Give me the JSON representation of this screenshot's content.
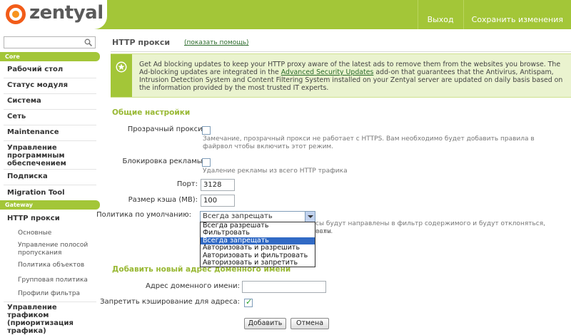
{
  "brand": {
    "logo_text": "zentyal"
  },
  "header": {
    "logout": "Выход",
    "save_changes": "Сохранить изменения"
  },
  "search": {
    "placeholder": ""
  },
  "sidebar": {
    "core_heading": "Core",
    "core_items": [
      "Рабочий стол",
      "Статус модуля",
      "Система",
      "Сеть",
      "Maintenance",
      "Управление программным обеспечением",
      "Подписка",
      "Migration Tool"
    ],
    "gateway_heading": "Gateway",
    "http_proxy": "HTTP прокси",
    "http_proxy_sub": [
      "Основные",
      "Управление полосой пропускания",
      "Политика объектов",
      "Групповая политика",
      "Профили фильтра"
    ],
    "traffic_shaping": "Управление трафиком (приоритизация трафика)"
  },
  "main": {
    "title": "HTTP прокси",
    "help_link": "(показать помощь)",
    "notice": {
      "text_1": "Get Ad blocking updates to keep your HTTP proxy aware of the latest ads to remove them from the websites you browse. The Ad-blocking updates are integrated in the ",
      "link": "Advanced Security Updates",
      "text_2": " add-on that guarantees that the Antivirus, Antispam, Intrusion Detection System and Content Filtering System installed on your Zentyal server are updated on daily basis based on the information provided by the most trusted IT experts."
    },
    "general": {
      "heading": "Общие настройки",
      "transparent_label": "Прозрачный прокси:",
      "transparent_checked": false,
      "transparent_hint": "Замечание, прозрачный прокси не работает с HTTPS. Вам необходимо будет добавить правила в файрвол чтобы включить этот режим.",
      "adblock_label": "Блокировка рекламы:",
      "adblock_checked": false,
      "adblock_hint": "Удаление рекламы из всего HTTP трафика",
      "port_label": "Порт:",
      "port_value": "3128",
      "cache_label": "Размер кэша (MB):",
      "cache_value": "100",
      "policy_label": "Политика по умолчанию:",
      "policy_value": "Всегда запрещать",
      "policy_options": [
        "Всегда разрешать",
        "Фильтровать",
        "Всегда запрещать",
        "Авторизовать и разрешить",
        "Авторизовать и фильтровать",
        "Авторизовать и запретить"
      ],
      "policy_selected_index": 2,
      "policy_hint_line1": "сы будут направлены в фильтр содержимого и будут отклоняться, если",
      "policy_hint_line2": "вать."
    },
    "add_domain": {
      "heading": "Добавить новый адрес доменного имени",
      "domain_label": "Адрес доменного имени:",
      "domain_value": "",
      "nocache_label": "Запретить кэширование для адреса:",
      "nocache_checked": true,
      "add_button": "Добавить",
      "cancel_button": "Отмена"
    }
  },
  "colors": {
    "brand_green": "#a3c638",
    "brand_orange": "#f25c19",
    "selection_blue": "#316ac5"
  }
}
